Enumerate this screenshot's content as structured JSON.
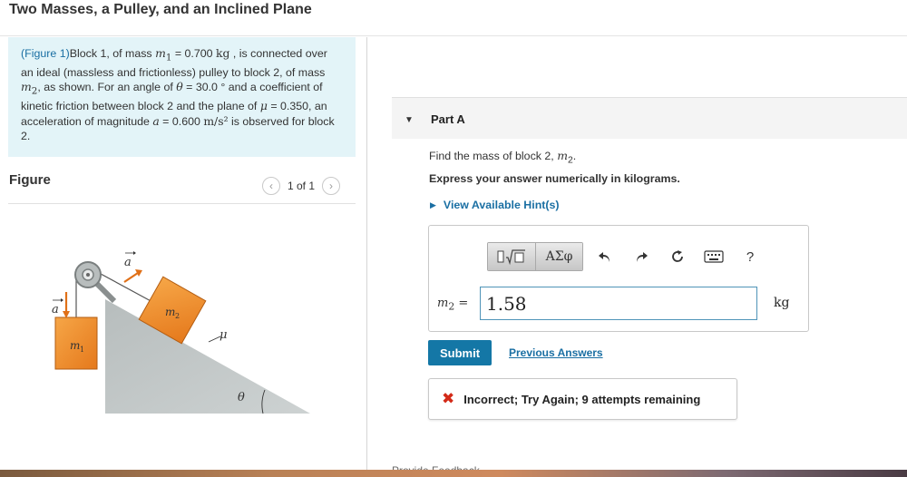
{
  "page": {
    "title": "Two Masses, a Pulley, and an Inclined Plane"
  },
  "problem": {
    "figure_link": "(Figure 1)",
    "text_1": "Block 1, of mass ",
    "m1_symbol": "m",
    "m1_sub": "1",
    "eq1": " = 0.700 ",
    "kg": "kg",
    "text_2": " , is connected over an ideal (massless and frictionless) pulley to block 2, of mass ",
    "m2_symbol": "m",
    "m2_sub": "2",
    "text_3": ", as shown. For an angle of ",
    "theta": "θ",
    "text_4": " = 30.0 ° and a coefficient of kinetic friction between block 2 and the plane of ",
    "mu": "μ",
    "text_5": " = 0.350, an acceleration of magnitude ",
    "a_symbol": "a",
    "text_6": " = 0.600 ",
    "accel_unit": "m/s²",
    "text_7": " is observed for block 2."
  },
  "figure": {
    "heading": "Figure",
    "pager_text": "1 of 1",
    "prev_icon": "chevron-left-icon",
    "next_icon": "chevron-right-icon",
    "labels": {
      "a_vec": "a",
      "m1": "m",
      "m1_sub": "1",
      "m2": "m",
      "m2_sub": "2",
      "mu": "μ",
      "theta": "θ"
    }
  },
  "part": {
    "label": "Part A",
    "question_text": "Find the mass of block 2, ",
    "question_var": "m",
    "question_sub": "2",
    "question_end": ".",
    "instruction": "Express your answer numerically in kilograms.",
    "hints_label": "View Available Hint(s)"
  },
  "toolbar": {
    "templates_icon": "templates-icon",
    "greek_label": "ΑΣφ",
    "undo_icon": "undo-icon",
    "redo_icon": "redo-icon",
    "reset_icon": "reset-icon",
    "keyboard_icon": "keyboard-icon",
    "help_label": "?"
  },
  "answer": {
    "var": "m",
    "sub": "2",
    "equals": " =",
    "value": "1.58",
    "unit": "kg"
  },
  "actions": {
    "submit": "Submit",
    "previous_answers": "Previous Answers"
  },
  "feedback": {
    "mark": "✖",
    "text": "Incorrect; Try Again; 9 attempts remaining"
  },
  "cutoff_text": "Provide Feedback",
  "colors": {
    "accent": "#1477a6",
    "link": "#1a6fa3",
    "problem_bg": "#e3f4f8",
    "block_orange": "#f2902d",
    "incline_gray": "#c3c8c8",
    "error_red": "#d32a18"
  }
}
